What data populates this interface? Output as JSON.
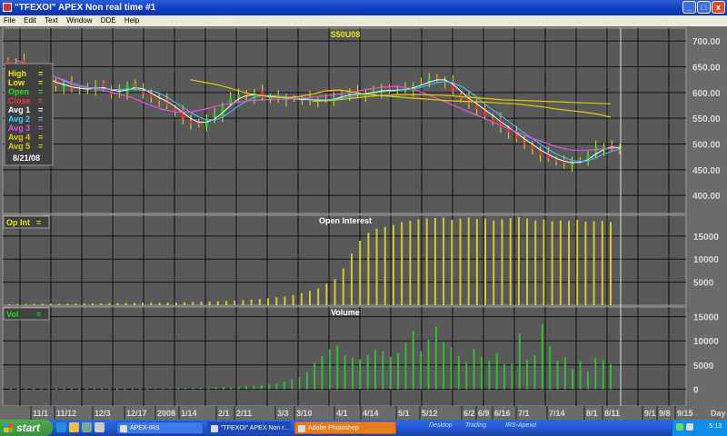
{
  "window": {
    "title": "\"TFEXOI\" APEX Non real time #1",
    "buttons": [
      "_",
      "□",
      "x"
    ]
  },
  "menu": [
    "File",
    "Edit",
    "Text",
    "Window",
    "DDE",
    "Help"
  ],
  "chart_data": [
    {
      "type": "candlestick",
      "title": "S50U08",
      "y_ticks": [
        "700.00",
        "650.00",
        "600.00",
        "550.00",
        "500.00",
        "450.00",
        "400.00"
      ],
      "y_tick_values": [
        700,
        650,
        600,
        550,
        500,
        450,
        400
      ],
      "ylim": [
        365,
        725
      ],
      "grid": true,
      "legend": [
        {
          "label": "High",
          "value": "=",
          "color": "#e8e800"
        },
        {
          "label": "Low",
          "value": "=",
          "color": "#e8e800"
        },
        {
          "label": "Open",
          "value": "=",
          "color": "#22dd22"
        },
        {
          "label": "Close",
          "value": "=",
          "color": "#ff3333"
        },
        {
          "label": "Avg  1",
          "value": "=",
          "color": "#ffffff"
        },
        {
          "label": "Avg  2",
          "value": "=",
          "color": "#33ccff"
        },
        {
          "label": "Avg  3",
          "value": "=",
          "color": "#dd55dd"
        },
        {
          "label": "Avg  4",
          "value": "=",
          "color": "#ddcc00"
        },
        {
          "label": "Avg  5",
          "value": "=",
          "color": "#ddcc00"
        }
      ],
      "legend_date": "8/21/08",
      "legend_placement": "top-left",
      "annotation": "¹1",
      "close_values": [
        655,
        658,
        648,
        640,
        628,
        620,
        612,
        615,
        606,
        604,
        610,
        612,
        607,
        596,
        604,
        615,
        610,
        596,
        590,
        584,
        574,
        561,
        548,
        540,
        538,
        549,
        558,
        575,
        592,
        596,
        594,
        598,
        590,
        592,
        590,
        586,
        588,
        586,
        585,
        585,
        586,
        590,
        598,
        599,
        596,
        600,
        604,
        605,
        604,
        605,
        608,
        614,
        620,
        626,
        628,
        620,
        600,
        588,
        578,
        568,
        554,
        544,
        532,
        522,
        510,
        498,
        490,
        478,
        472,
        466,
        462,
        463,
        468,
        478,
        495,
        496,
        492,
        488
      ],
      "avg_lines": [
        {
          "name": "Avg 3",
          "color": "#dd55dd",
          "values": [
            665,
            652,
            640,
            628,
            618,
            610,
            604,
            598,
            590,
            578,
            568,
            562,
            562,
            568,
            575,
            580,
            584,
            586,
            587,
            588,
            590,
            593,
            597,
            601,
            606,
            610,
            612,
            608,
            598,
            586,
            574,
            562,
            550,
            538,
            526,
            514,
            504,
            494,
            488,
            488,
            490,
            492
          ]
        },
        {
          "name": "Avg 4",
          "color": "#ddcc00",
          "values": [
            null,
            null,
            null,
            null,
            null,
            null,
            null,
            null,
            null,
            null,
            625,
            620,
            615,
            608,
            600,
            595,
            591,
            590,
            592,
            597,
            603,
            605,
            601,
            597,
            594,
            592,
            590,
            588,
            586,
            584,
            583,
            582,
            581,
            579,
            578,
            575,
            572,
            568,
            565,
            562,
            558,
            552
          ]
        },
        {
          "name": "Avg 5",
          "color": "#ddcc00",
          "values": [
            null,
            null,
            null,
            null,
            null,
            null,
            null,
            null,
            null,
            null,
            null,
            null,
            null,
            null,
            null,
            null,
            null,
            null,
            null,
            583,
            584,
            586,
            589,
            592,
            594,
            595,
            596,
            596,
            595,
            594,
            592,
            590,
            588,
            586,
            585,
            584,
            583,
            582,
            581,
            580,
            579,
            578
          ]
        }
      ]
    },
    {
      "type": "bar",
      "title": "Open  Interest",
      "legend": [
        {
          "label": "Op  Int",
          "value": "=",
          "color": "#e8e800"
        }
      ],
      "y_ticks": [
        "15000",
        "10000",
        "5000"
      ],
      "y_tick_values": [
        15000,
        10000,
        5000
      ],
      "ylim": [
        0,
        19500
      ],
      "values": [
        200,
        220,
        240,
        260,
        280,
        300,
        320,
        340,
        360,
        380,
        400,
        420,
        440,
        460,
        480,
        500,
        520,
        540,
        560,
        580,
        600,
        650,
        700,
        750,
        800,
        850,
        900,
        1000,
        1100,
        1200,
        1350,
        1500,
        1700,
        1900,
        2200,
        2600,
        3100,
        3700,
        4600,
        5700,
        8000,
        11200,
        14000,
        15700,
        16600,
        17000,
        17400,
        18000,
        18300,
        18600,
        18800,
        18900,
        19000,
        18500,
        18800,
        19000,
        18700,
        18800,
        18400,
        18600,
        18900,
        19100,
        18800,
        18400,
        18600,
        18200,
        18400,
        18300,
        18500,
        18100,
        18200,
        18300,
        18000
      ]
    },
    {
      "type": "bar",
      "title": "Volume",
      "legend": [
        {
          "label": "Vol",
          "value": "=",
          "color": "#22dd22"
        }
      ],
      "y_ticks": [
        "15000",
        "10000",
        "5000",
        "0"
      ],
      "y_tick_values": [
        15000,
        10000,
        5000,
        0
      ],
      "ylim": [
        -3500,
        17000
      ],
      "values": [
        100,
        100,
        100,
        100,
        100,
        100,
        100,
        100,
        100,
        100,
        100,
        100,
        100,
        100,
        100,
        100,
        100,
        100,
        100,
        150,
        150,
        200,
        200,
        250,
        250,
        300,
        300,
        350,
        400,
        450,
        500,
        600,
        700,
        800,
        1000,
        1200,
        1500,
        2000,
        2500,
        3500,
        5500,
        6800,
        8200,
        9000,
        7000,
        6600,
        6200,
        7100,
        8200,
        7800,
        6700,
        7500,
        9500,
        12000,
        7800,
        10200,
        13000,
        9800,
        8700,
        6900,
        5600,
        8300,
        6700,
        5900,
        7500,
        5200,
        5400,
        11500,
        6100,
        7000,
        13500,
        8800,
        5900,
        6700,
        4200,
        5800,
        3700,
        6400,
        6000,
        5100
      ]
    }
  ],
  "x_axis": {
    "labels": [
      "11/1",
      "11/12",
      "12/3",
      "12/17",
      "2008",
      "1/14",
      "2/1",
      "2/11",
      "3/3",
      "3/10",
      "4/1",
      "4/14",
      "5/1",
      "5/12",
      "6/2",
      "6/9",
      "6/16",
      "7/1",
      "7/14",
      "8/1",
      "8/11",
      "9/1",
      "9/8",
      "9/15"
    ],
    "axis_name": "Day"
  },
  "taskbar": {
    "start_label": "start",
    "tasks": [
      {
        "label": "APEX-IRS",
        "active": false
      },
      {
        "label": "\"TFEXOI\" APEX Non r...",
        "active": true
      },
      {
        "label": "Adobe Photoshop",
        "active": false
      }
    ],
    "tray_items": [
      "Desktop",
      "Trading",
      "IRS-Apexd"
    ],
    "clock": "5:13"
  }
}
